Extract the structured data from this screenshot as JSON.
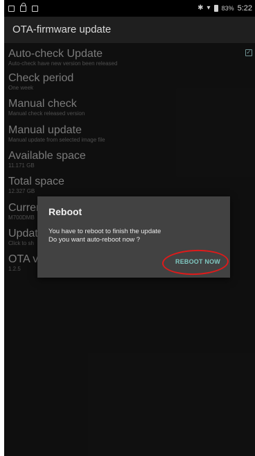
{
  "status_bar": {
    "left_icons": [
      "image-icon",
      "lock-icon",
      "square-icon"
    ],
    "bluetooth": "✱",
    "signal": "▾",
    "battery_text": "83%",
    "time": "5:22"
  },
  "app": {
    "title": "OTA-firmware update"
  },
  "preferences": [
    {
      "title": "Auto-check Update",
      "subtitle": "Auto-check have new version been released",
      "checked": true
    },
    {
      "title": "Check period",
      "subtitle": "One week"
    },
    {
      "title": "Manual check",
      "subtitle": "Manual check released version"
    },
    {
      "title": "Manual update",
      "subtitle": "Manual update from selected image file"
    },
    {
      "title": "Available space",
      "subtitle": "11.171 GB"
    },
    {
      "title": "Total space",
      "subtitle": "12.327 GB"
    },
    {
      "title": "Curren",
      "subtitle": "M700DMB"
    },
    {
      "title": "Update",
      "subtitle": "Click to sh"
    },
    {
      "title": "OTA ve",
      "subtitle": "1.2.5"
    }
  ],
  "dialog": {
    "title": "Reboot",
    "line1": "You have to reboot to finish the update",
    "line2": "Do you want auto-reboot now ?",
    "button": "REBOOT NOW"
  },
  "colors": {
    "background": "#121212",
    "accent": "#7fc7c0",
    "annotation": "#e01a1a"
  }
}
